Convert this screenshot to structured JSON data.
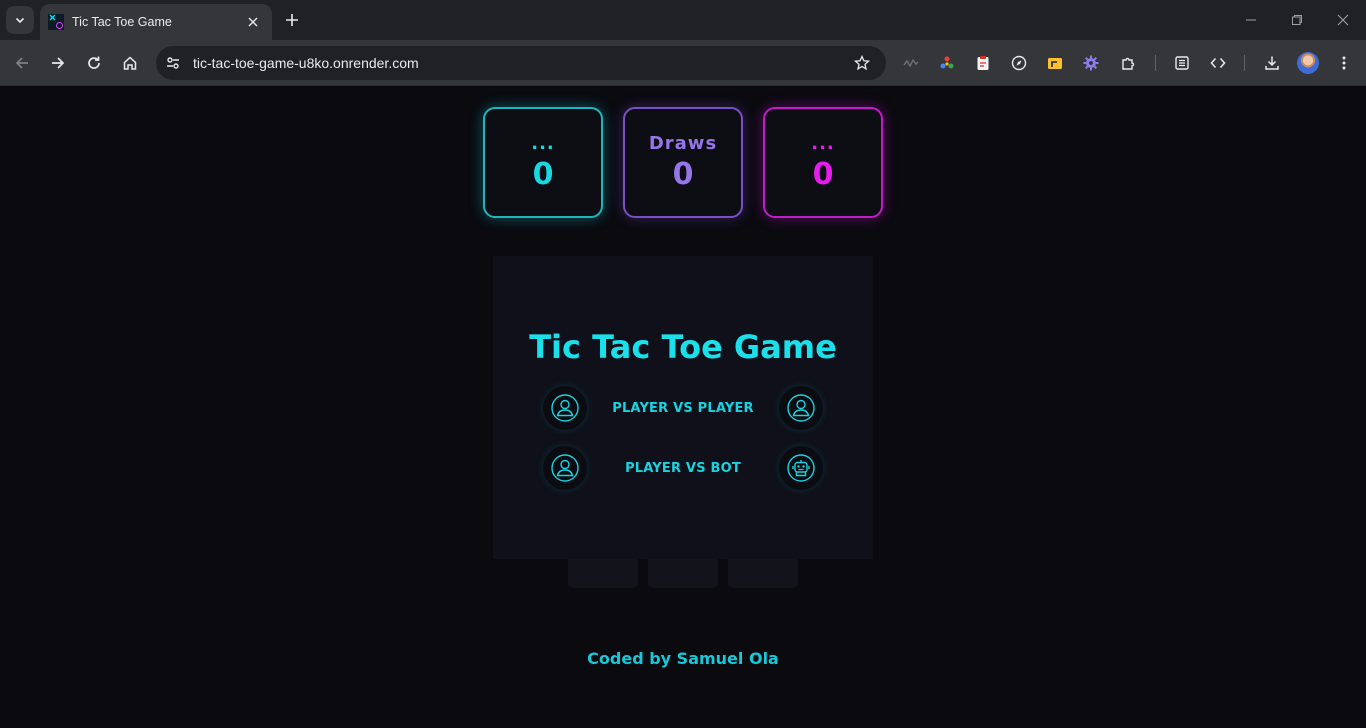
{
  "browser": {
    "tab_title": "Tic Tac Toe Game",
    "url": "tic-tac-toe-game-u8ko.onrender.com"
  },
  "scoreboard": {
    "player_x": {
      "name": "...",
      "score": "0",
      "color": "#16d9e3"
    },
    "draws": {
      "name": "Draws",
      "score": "0",
      "color": "#9575e8"
    },
    "player_o": {
      "name": "...",
      "score": "0",
      "color": "#e81cf0"
    }
  },
  "modal": {
    "title": "Tic Tac Toe Game",
    "modes": [
      {
        "label": "PLAYER VS PLAYER",
        "left_icon": "user-icon",
        "right_icon": "user-icon"
      },
      {
        "label": "PLAYER VS BOT",
        "left_icon": "user-icon",
        "right_icon": "robot-icon"
      }
    ]
  },
  "footer": {
    "credit": "Coded by Samuel Ola"
  },
  "colors": {
    "accent": "#19e0ea",
    "background": "#0a0a0f"
  }
}
